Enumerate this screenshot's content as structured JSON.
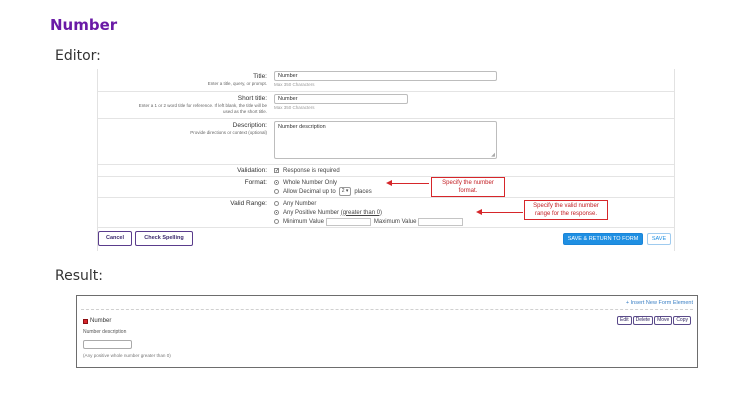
{
  "page": {
    "title": "Number"
  },
  "sections": {
    "editor": "Editor:",
    "result": "Result:"
  },
  "editor": {
    "title": {
      "label": "Title:",
      "help": "Enter a title, query, or prompt.",
      "value": "Number",
      "hint": "Max 350 Characters"
    },
    "short_title": {
      "label": "Short title:",
      "help_line1": "Enter a 1 or 2 word title for reference. If left blank, the title will be",
      "help_line2": "used as the short title.",
      "value": "Number",
      "hint": "Max 350 Characters"
    },
    "description": {
      "label": "Description:",
      "help": "Provide directions or context (optional)",
      "value": "Number description"
    },
    "validation": {
      "label": "Validation:",
      "option": "Response is required",
      "checked": true
    },
    "format": {
      "label": "Format:",
      "option1": "Whole Number Only",
      "option2_prefix": "Allow Decimal up to",
      "option2_value": "2",
      "option2_suffix": "places",
      "selected": "Whole Number Only"
    },
    "valid_range": {
      "label": "Valid Range:",
      "option1": "Any Number",
      "option2_prefix": "Any Positive Number",
      "option2_emphasis": "(greater than 0)",
      "option3_min": "Minimum Value",
      "option3_max": "Maximum Value",
      "selected": "Any Positive Number (greater than 0)"
    },
    "callouts": {
      "format_line1": "Specify the number",
      "format_line2": "format.",
      "range_line1": "Specify the valid number",
      "range_line2": "range for the response."
    },
    "buttons": {
      "cancel": "Cancel",
      "spelling": "Check Spelling",
      "save_return": "SAVE & RETURN TO FORM",
      "save": "SAVE"
    }
  },
  "result": {
    "insert_link": "+ Insert New Form Element",
    "field_title": "Number",
    "field_description": "Number description",
    "field_hint": "(Any positive whole number greater than 0)",
    "actions": [
      "Edit",
      "Delete",
      "Move",
      "Copy"
    ]
  },
  "colors": {
    "heading": "#6a1aa6",
    "callout": "#d6262a",
    "primary_button": "#1f8fe2",
    "link": "#3a7fc4"
  }
}
